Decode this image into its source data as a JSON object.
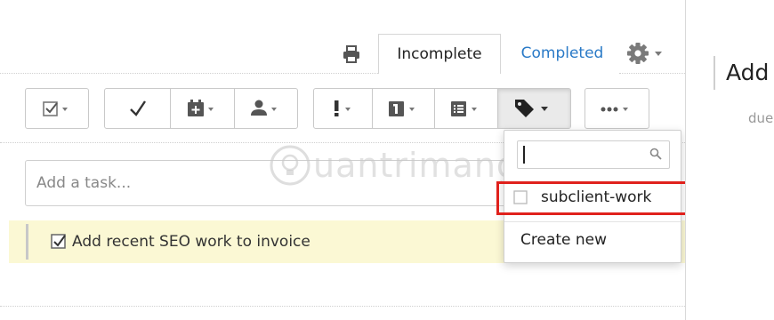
{
  "tabs": {
    "incomplete": "Incomplete",
    "completed": "Completed"
  },
  "icons": {
    "print": "printer-icon",
    "settings": "gear-icon",
    "checkbox_menu": "checkbox-icon",
    "complete": "checkmark-icon",
    "due_date": "calendar-plus-icon",
    "assign": "person-icon",
    "priority": "exclamation-icon",
    "calendar": "calendar-day-icon",
    "list": "list-icon",
    "tag": "tag-icon",
    "more": "ellipsis-icon",
    "search": "magnifier-icon"
  },
  "add_task": {
    "placeholder": "Add a task..."
  },
  "task": {
    "label": "Add recent SEO work to invoice",
    "checked": true
  },
  "tag_dropdown": {
    "search_value": "",
    "items": [
      {
        "label": "subclient-work",
        "checked": false
      }
    ],
    "create_new": "Create new"
  },
  "watermark": "uantrimang",
  "right_pane": {
    "title": "Add",
    "due": "due"
  },
  "colors": {
    "accent": "#2a7ac7",
    "task_highlight": "#fbf8d4",
    "annotation": "#e0211c"
  }
}
